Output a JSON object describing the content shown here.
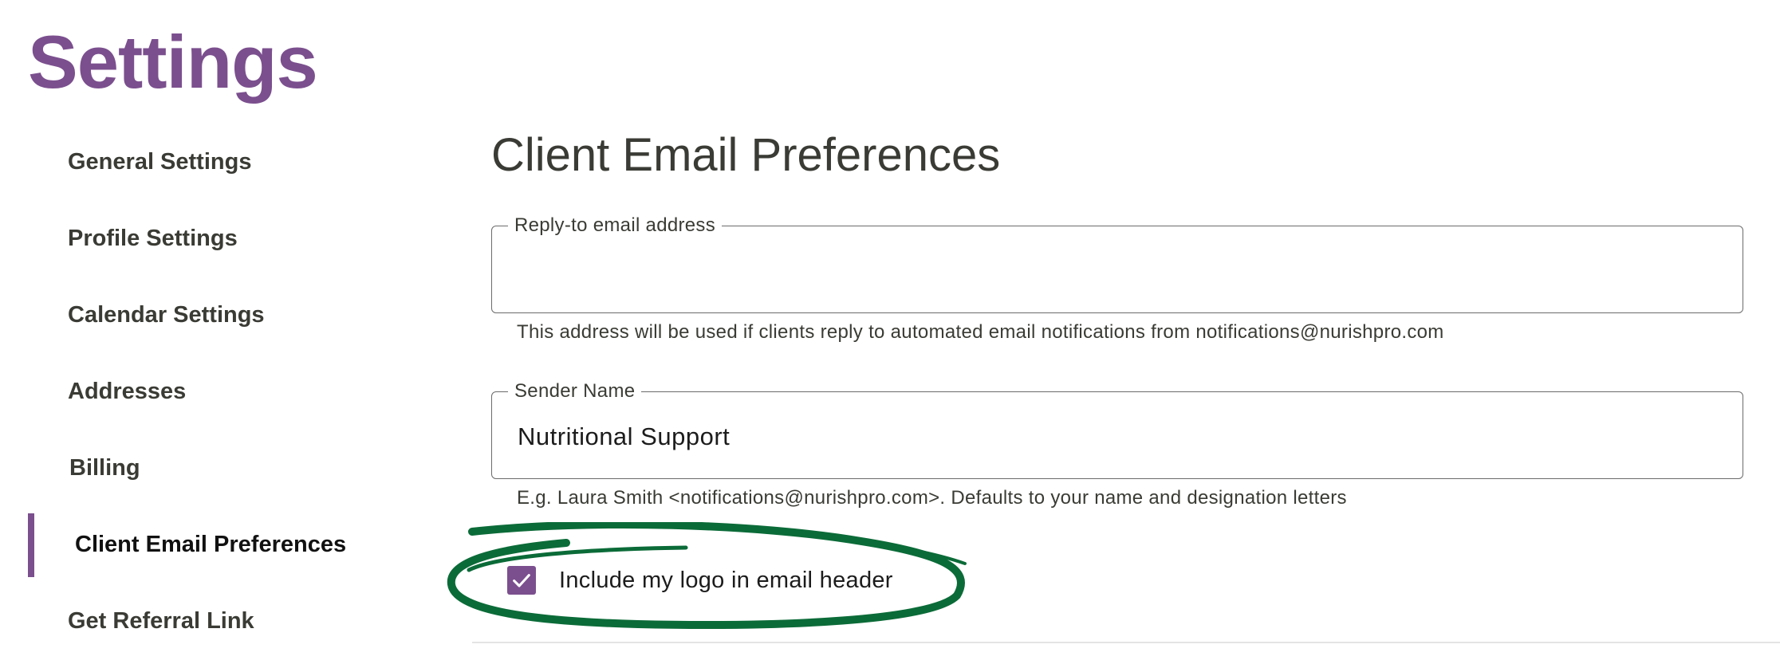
{
  "page": {
    "title": "Settings"
  },
  "sidebar": {
    "items": [
      {
        "label": "General Settings",
        "active": false
      },
      {
        "label": "Profile Settings",
        "active": false
      },
      {
        "label": "Calendar Settings",
        "active": false
      },
      {
        "label": "Addresses",
        "active": false
      },
      {
        "label": "Billing",
        "active": false
      },
      {
        "label": "Client Email Preferences",
        "active": true
      },
      {
        "label": "Get Referral Link",
        "active": false
      }
    ]
  },
  "main": {
    "section_title": "Client Email Preferences",
    "reply_to": {
      "label": "Reply-to email address",
      "value": "",
      "helper": "This address will be used if clients reply to automated email notifications from notifications@nurishpro.com"
    },
    "sender_name": {
      "label": "Sender Name",
      "value": "Nutritional Support",
      "helper": "E.g. Laura Smith <notifications@nurishpro.com>. Defaults to your name and designation letters"
    },
    "logo_checkbox": {
      "label": "Include my logo in email header",
      "checked": true
    }
  },
  "colors": {
    "brand": "#7b4f8e",
    "annotation": "#0b6b38",
    "text": "#3b3b35"
  },
  "icons": {
    "checkbox": "check-icon"
  }
}
